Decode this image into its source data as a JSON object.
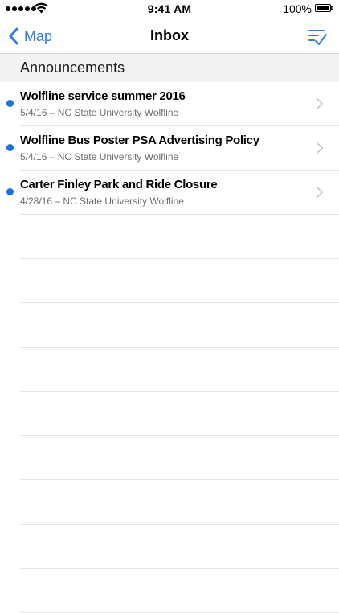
{
  "status_bar": {
    "time": "9:41 AM",
    "battery_percent": "100%",
    "signal_bars": 5,
    "icons": [
      "signal-icon",
      "wifi-icon",
      "battery-icon"
    ]
  },
  "nav": {
    "back_label": "Map",
    "title": "Inbox",
    "back_icon": "chevron-left-icon",
    "action_icon": "mark-all-read-icon"
  },
  "section": {
    "title": "Announcements"
  },
  "messages": [
    {
      "title": "Wolfline service summer 2016",
      "subtitle": "5/4/16 – NC State University Wolfline",
      "unread": true
    },
    {
      "title": "Wolfline Bus Poster PSA Advertising Policy",
      "subtitle": "5/4/16 – NC State University Wolfline",
      "unread": true
    },
    {
      "title": "Carter Finley Park and Ride Closure",
      "subtitle": "4/28/16 – NC State University Wolfline",
      "unread": true
    }
  ],
  "colors": {
    "accent": "#2f7ce8",
    "unread_dot": "#1f6fdc",
    "section_bg": "#f2f2f2",
    "subtitle": "#6e6e6e"
  }
}
